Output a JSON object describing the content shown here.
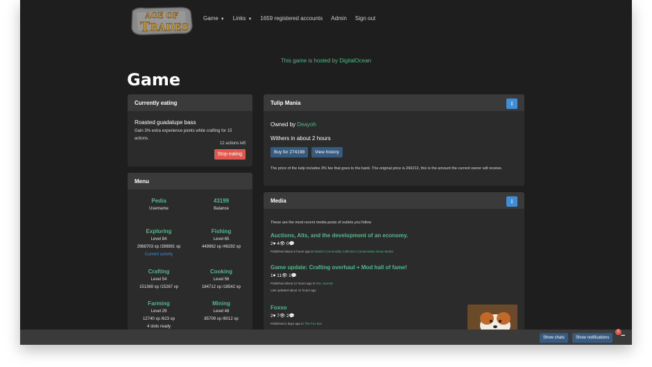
{
  "brand": {
    "logo_line1": "AGE OF",
    "logo_line2": "RADES"
  },
  "nav": {
    "game": "Game",
    "links": "Links",
    "accounts": "1659 registered accounts",
    "admin": "Admin",
    "signout": "Sign out"
  },
  "hosted": "This game is hosted by DigitalOcean",
  "page_title": "Game",
  "eating": {
    "title": "Currently eating",
    "food": "Roasted guadalupe bass",
    "desc": "Gain 3% extra experience points while crafting for 15 actions.",
    "actions_left": "12 actions left",
    "stop": "Stop eating"
  },
  "menu": {
    "title": "Menu",
    "stats": [
      {
        "name": "Pedia",
        "l1": "Username",
        "l2": "",
        "l3": ""
      },
      {
        "name": "43199",
        "l1": "Balance",
        "l2": "",
        "l3": ""
      },
      {
        "name": "Exploring",
        "l1": "Level 84",
        "l2": "2968703 xp /289891 xp",
        "l3": "Current activity"
      },
      {
        "name": "Fishing",
        "l1": "Level 65",
        "l2": "449962 xp /46292 xp",
        "l3": ""
      },
      {
        "name": "Crafting",
        "l1": "Level 54",
        "l2": "151369 xp /15267 xp",
        "l3": ""
      },
      {
        "name": "Cooking",
        "l1": "Level 56",
        "l2": "184712 xp /18542 xp",
        "l3": ""
      },
      {
        "name": "Farming",
        "l1": "Level 29",
        "l2": "12740 xp /623 xp",
        "l3": "4 slots ready"
      },
      {
        "name": "Mining",
        "l1": "Level 48",
        "l2": "85709 xp /6012 xp",
        "l3": ""
      }
    ]
  },
  "tulip": {
    "title": "Tulip Mania",
    "info": "i",
    "owned_prefix": "Owned by ",
    "owner": "Deayoh",
    "withers": "Withers in about 2 hours",
    "buy": "Buy for 274198",
    "history": "View history",
    "note": "The price of the tulip includes 3% fee that goes to the bank. The original price is 266212, this is the amount the current owner will receive."
  },
  "media": {
    "title": "Media",
    "info": "i",
    "intro": "These are the most recent media posts of outlets you follow",
    "posts": [
      {
        "title": "Auctions, Alts, and the development of an economy.",
        "counts": "2♥  4👁  0💬",
        "meta": "Published about 6 hours ago in ",
        "outlet": "Wada's Commodity Collection Conservation News Media",
        "extra": ""
      },
      {
        "title": "Game update: Crafting overhaul + Mod hall of fame!",
        "counts": "1♥  11👁  1💬",
        "meta": "Published about 11 hours ago in ",
        "outlet": "Dev Journal",
        "extra": "Last updated about 11 hours ago"
      },
      {
        "title": "Foxxo",
        "counts": "2♥  7👁  2💬",
        "meta": "Published 2 days ago in ",
        "outlet": "The Fox Box",
        "extra": ""
      }
    ]
  },
  "footer": {
    "chats": "Show chats",
    "notifications": "Show notifications",
    "badge": "5",
    "minus": "−"
  },
  "icons": {
    "caret": "caret-down-icon",
    "info": "info-icon",
    "heart": "heart-icon",
    "eye": "eye-icon",
    "comment": "comment-icon"
  },
  "colors": {
    "background": "#1e1e1e",
    "panel": "#2b2b2b",
    "accent_green": "#53b98f",
    "button_blue": "#375a7f",
    "danger": "#e2564b",
    "info": "#3f8fd8"
  }
}
